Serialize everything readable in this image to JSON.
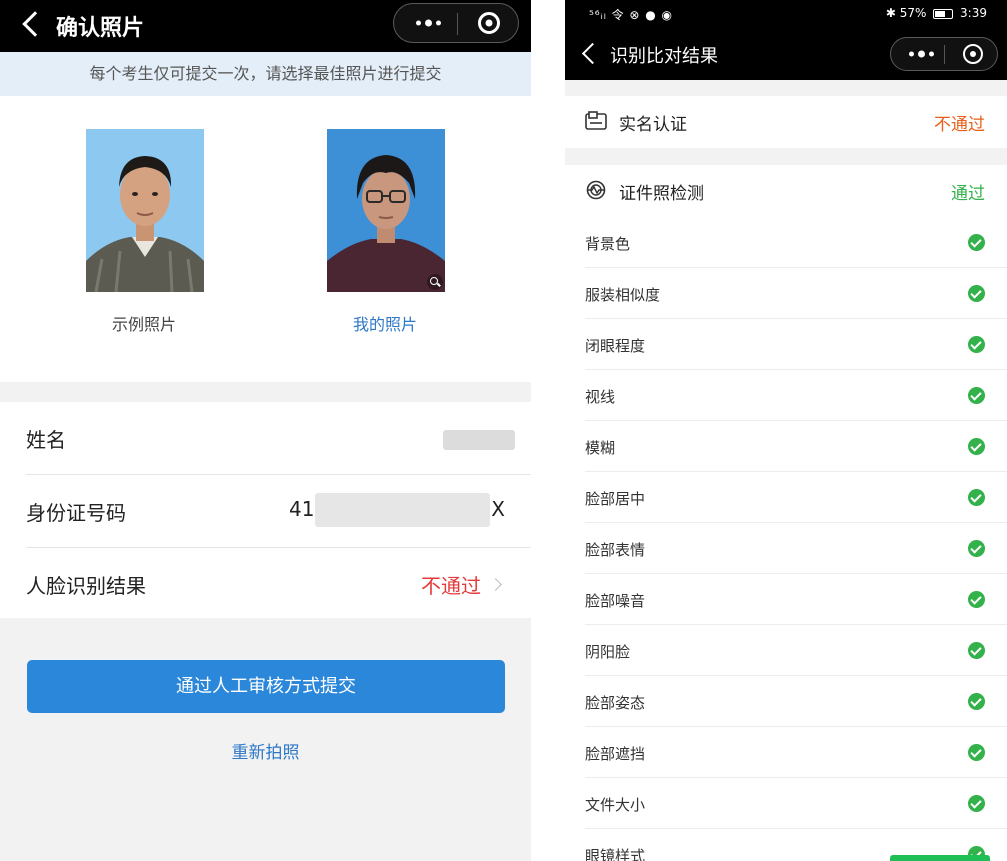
{
  "left": {
    "title": "确认照片",
    "notice": "每个考生仅可提交一次，请选择最佳照片进行提交",
    "photos": [
      {
        "caption": "示例照片"
      },
      {
        "caption": "我的照片"
      }
    ],
    "info": [
      {
        "label": "姓名",
        "value": ""
      },
      {
        "label": "身份证号码",
        "value_prefix": "41",
        "value_suffix": "X"
      },
      {
        "label": "人脸识别结果",
        "value": "不通过"
      }
    ],
    "primary_button": "通过人工审核方式提交",
    "secondary_link": "重新拍照",
    "colors": {
      "accent": "#2b87d9",
      "fail": "#e33b3b",
      "notice_bg": "#e4eef8"
    }
  },
  "right": {
    "status_bar": {
      "left": "⁵⁶ᵢₗ 令 ⊗ ● ◉",
      "battery": "57%",
      "time": "3:39"
    },
    "title": "识别比对结果",
    "sections": [
      {
        "label": "实名认证",
        "result": "不通过",
        "icon": "id-card-icon"
      },
      {
        "label": "证件照检测",
        "result": "通过",
        "icon": "face-scan-icon"
      }
    ],
    "checks": [
      {
        "label": "背景色"
      },
      {
        "label": "服装相似度"
      },
      {
        "label": "闭眼程度"
      },
      {
        "label": "视线"
      },
      {
        "label": "模糊"
      },
      {
        "label": "脸部居中"
      },
      {
        "label": "脸部表情"
      },
      {
        "label": "脸部噪音"
      },
      {
        "label": "阴阳脸"
      },
      {
        "label": "脸部姿态"
      },
      {
        "label": "脸部遮挡"
      },
      {
        "label": "文件大小"
      },
      {
        "label": "眼镜样式"
      }
    ],
    "colors": {
      "pass": "#33b14a",
      "fail": "#e8601c"
    }
  }
}
